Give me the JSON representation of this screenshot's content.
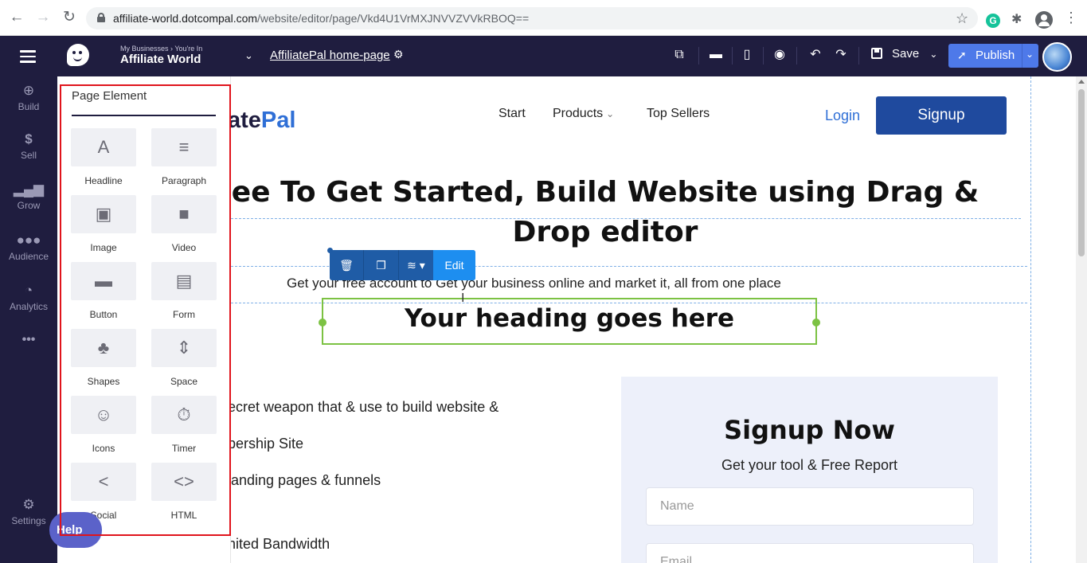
{
  "browser": {
    "url_host": "affiliate-world.dotcompal.com",
    "url_path": "/website/editor/page/Vkd4U1VrMXJNVVZVVkRBOQ==",
    "extension_letter": "G"
  },
  "header": {
    "breadcrumb": "My Businesses › You're In",
    "business_name": "Affiliate World",
    "page_name": "AffiliatePal home-page",
    "save_label": "Save",
    "publish_label": "Publish"
  },
  "rail": {
    "items": [
      {
        "label": "Build",
        "icon": "plus-circle-icon"
      },
      {
        "label": "Sell",
        "icon": "dollar-icon"
      },
      {
        "label": "Grow",
        "icon": "bar-chart-icon"
      },
      {
        "label": "Audience",
        "icon": "people-icon"
      },
      {
        "label": "Analytics",
        "icon": "analytics-icon"
      },
      {
        "label": "•••",
        "icon": "more-icon"
      },
      {
        "label": "Settings",
        "icon": "gear-icon"
      }
    ]
  },
  "panel": {
    "title": "Page Element",
    "elements": [
      {
        "label": "Headline",
        "glyph": "A"
      },
      {
        "label": "Paragraph",
        "glyph": "≡"
      },
      {
        "label": "Image",
        "glyph": "▣"
      },
      {
        "label": "Video",
        "glyph": "■"
      },
      {
        "label": "Button",
        "glyph": "▬"
      },
      {
        "label": "Form",
        "glyph": "▤"
      },
      {
        "label": "Shapes",
        "glyph": "♣"
      },
      {
        "label": "Space",
        "glyph": "⇕"
      },
      {
        "label": "Icons",
        "glyph": "☺"
      },
      {
        "label": "Timer",
        "glyph": "⏱"
      },
      {
        "label": "Social",
        "glyph": "<"
      },
      {
        "label": "HTML",
        "glyph": "<>"
      }
    ],
    "help_label": "Help"
  },
  "site": {
    "brand_dark": "ate",
    "brand_blue": "Pal",
    "nav": [
      "Start",
      "Products",
      "Top Sellers"
    ],
    "login": "Login",
    "signup": "Signup",
    "hero_title": "ee To Get Started, Build Website using Drag & Drop editor",
    "hero_subtitle": "Get your free account to Get your business online and market it, all from one place",
    "selected_heading": "Your heading goes here",
    "toolbar_edit": "Edit",
    "features": [
      "ecret weapon that & use to build website &",
      "bership Site",
      " landing pages & funnels",
      "nited Bandwidth"
    ],
    "card": {
      "title": "Signup Now",
      "subtitle": "Get your tool & Free Report",
      "name_placeholder": "Name",
      "email_placeholder": "Email"
    }
  },
  "colors": {
    "app_dark": "#1f1d3f",
    "publish_blue": "#4e79e9",
    "brand_blue": "#2f6fd6",
    "signup_blue": "#1f4a9e",
    "selection_green": "#7cc243",
    "highlight_red": "#e0141c"
  }
}
